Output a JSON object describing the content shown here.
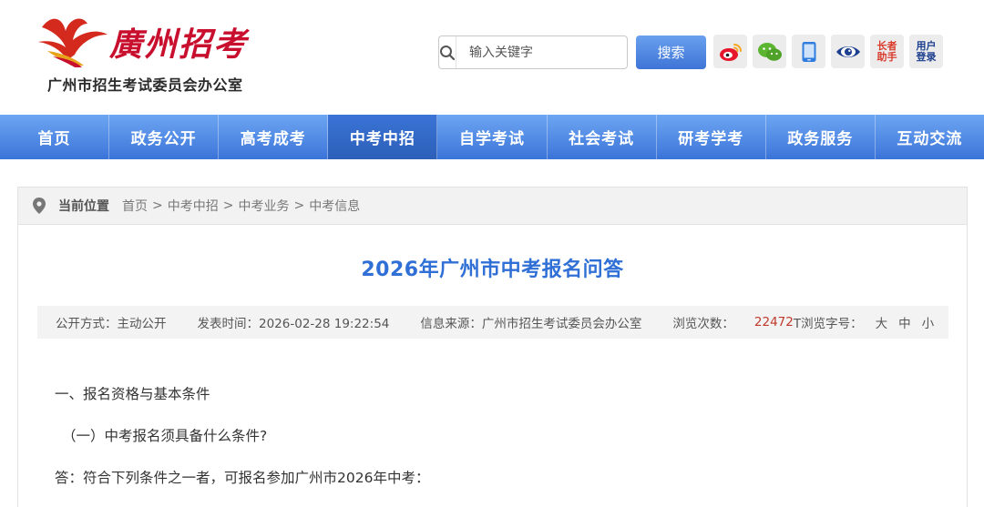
{
  "header": {
    "logo_script": "廣州招考",
    "logo_subtitle": "广州市招生考试委员会办公室",
    "search_placeholder": "输入关键字",
    "search_button": "搜索",
    "tools": {
      "weibo_icon": "weibo-icon",
      "wechat_icon": "wechat-icon",
      "mobile_icon": "mobile-icon",
      "accessibility_icon": "eye-icon",
      "elder_assist": [
        "长者",
        "助手"
      ],
      "user_login": [
        "用户",
        "登录"
      ]
    }
  },
  "nav": {
    "items": [
      "首页",
      "政务公开",
      "高考成考",
      "中考中招",
      "自学考试",
      "社会考试",
      "研考学考",
      "政务服务",
      "互动交流"
    ],
    "active_index": 3
  },
  "breadcrumb": {
    "label": "当前位置",
    "items": [
      "首页",
      "中考中招",
      "中考业务",
      "中考信息"
    ]
  },
  "article": {
    "title": "2026年广州市中考报名问答",
    "meta": {
      "open_mode": "公开方式：主动公开",
      "publish_time": "发表时间：2026-02-28 19:22:54",
      "source": "信息来源：广州市招生考试委员会办公室",
      "views_label": "浏览次数：",
      "views_value": "22472",
      "font_size_label": "T浏览字号：",
      "font_large": "大",
      "font_medium": "中",
      "font_small": "小"
    },
    "paragraphs": [
      "一、报名资格与基本条件",
      "（一）中考报名须具备什么条件?",
      "答：符合下列条件之一者，可报名参加广州市2026年中考："
    ]
  },
  "colors": {
    "nav_blue": "#3b74d9",
    "title_blue": "#2f6fd6",
    "logo_red": "#c8102e",
    "views_red": "#c0392b"
  }
}
